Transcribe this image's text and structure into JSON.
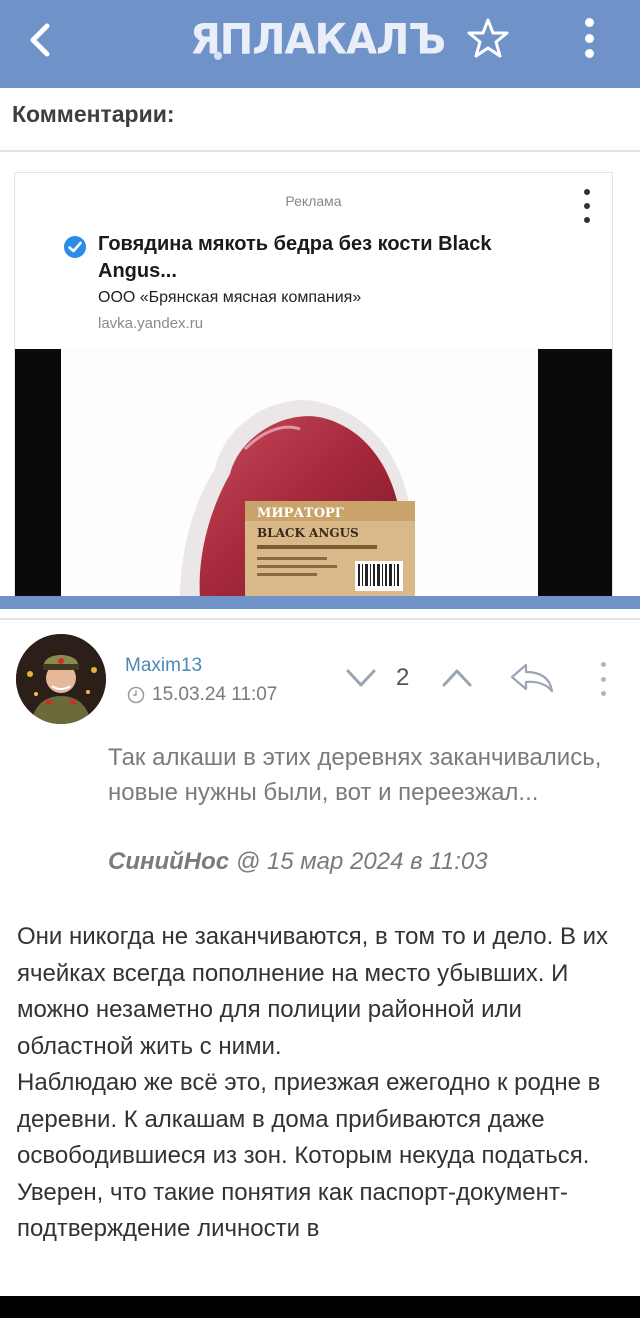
{
  "topbar": {
    "logo": "ЯПЛАКАЛЪ",
    "back_icon": "chevron-left-icon",
    "star_icon": "star-outline-icon",
    "menu_icon": "vertical-dots-icon"
  },
  "section": {
    "heading": "Комментарии:"
  },
  "ad": {
    "label": "Реклама",
    "title": "Говядина мякоть бедра без кости Black Angus...",
    "company": "ООО «Брянская мясная компания»",
    "domain": "lavka.yandex.ru",
    "package_text_brand": "МИРАТОРГ",
    "package_text_product": "BLACK ANGUS"
  },
  "comment": {
    "username": "Maxim13",
    "timestamp": "15.03.24 11:07",
    "votes": "2",
    "quote": {
      "text": "Так алкаши в этих деревнях заканчивались, новые нужны были, вот и переезжал...",
      "author": "СинийНос",
      "meta": " @ 15 мар 2024 в 11:03"
    },
    "body": [
      "Они никогда не заканчиваются, в том то и дело. В их ячейках всегда пополнение на место убывших. И можно незаметно для полиции районной или областной жить с ними.",
      "Наблюдаю же всё это, приезжая ежегодно к родне в деревни. К алкашам в дома прибиваются даже освободившиеся из зон. Которым некуда податься.",
      "Уверен, что такие понятия как паспорт-документ-подтверждение личности в"
    ]
  },
  "colors": {
    "topbar": "#6f93c9",
    "username": "#4d88b5",
    "quote": "#7b7b7b",
    "body": "#333333"
  }
}
